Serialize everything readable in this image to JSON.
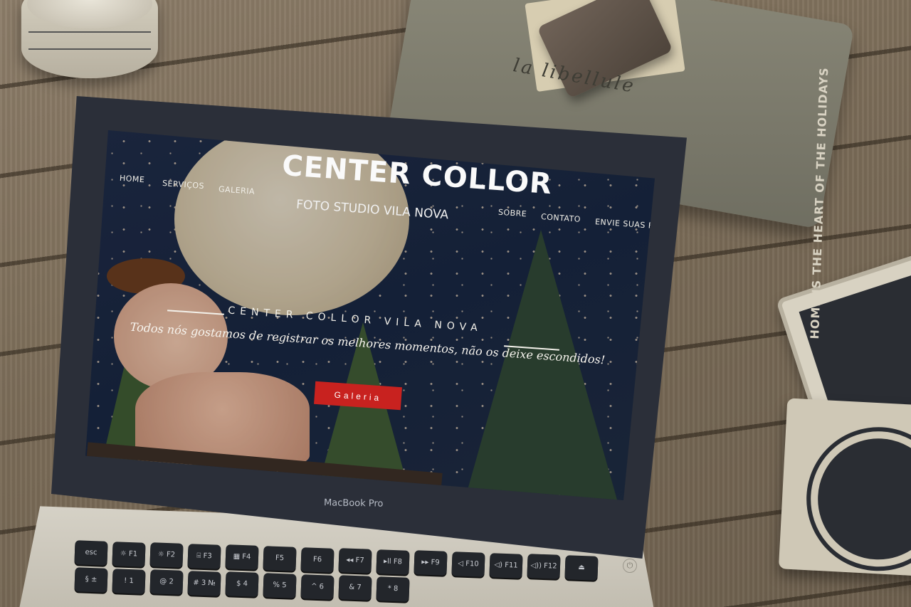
{
  "site": {
    "logo_title": "CENTER COLLOR",
    "logo_subtitle": "FOTO STUDIO VILA NOVA",
    "nav_left": [
      "HOME",
      "SERVIÇOS",
      "GALERIA"
    ],
    "nav_right": [
      "SOBRE",
      "CONTATO",
      "ENVIE SUAS F"
    ]
  },
  "hero": {
    "eyebrow": "CENTER COLLOR VILA NOVA",
    "tagline": "Todos nós gostamos de registrar os melhores momentos, não os deixe escondidos!",
    "cta_label": "Galeria"
  },
  "laptop": {
    "brand": "MacBook Pro",
    "keys_row1": [
      "esc",
      "☼ F1",
      "☼ F2",
      "⌸ F3",
      "▦ F4",
      "F5",
      "F6",
      "◂◂ F7",
      "▸ll F8",
      "▸▸ F9",
      "◁ F10",
      "◁) F11",
      "◁)) F12",
      "⏏"
    ],
    "keys_row2": [
      "§ ±",
      "! 1",
      "@ 2",
      "# 3 №",
      "$ 4",
      "% 5",
      "^ 6",
      "& 7",
      "* 8"
    ]
  },
  "props": {
    "pouch_text": "la libellule",
    "coaster_text": "HOME IS THE HEART OF THE HOLIDAYS"
  },
  "colors": {
    "cta": "#c8221f",
    "screen_sky": "#1e2a44",
    "laptop_frame": "#2b2f39"
  }
}
